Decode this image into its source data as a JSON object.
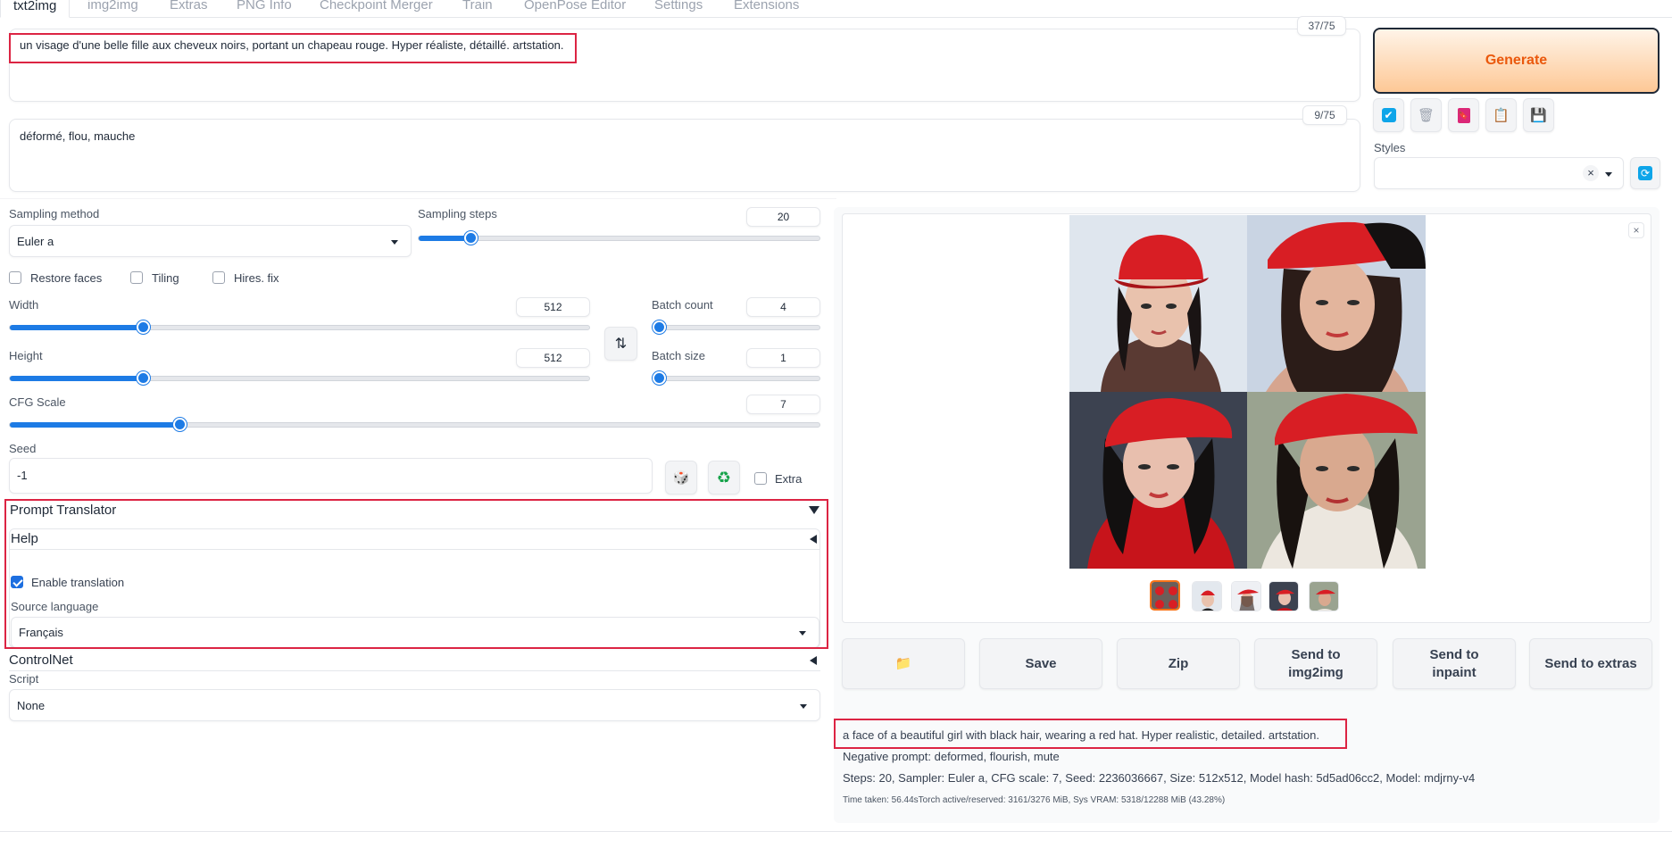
{
  "tabs": [
    "txt2img",
    "img2img",
    "Extras",
    "PNG Info",
    "Checkpoint Merger",
    "Train",
    "OpenPose Editor",
    "Settings",
    "Extensions"
  ],
  "prompt": {
    "text": "un visage d'une belle fille aux cheveux noirs, portant un chapeau rouge. Hyper réaliste, détaillé. artstation.",
    "counter": "37/75"
  },
  "negative_prompt": {
    "text": "déformé, flou, mauche",
    "counter": "9/75"
  },
  "generate_label": "Generate",
  "styles": {
    "label": "Styles",
    "value": ""
  },
  "sampling": {
    "method_label": "Sampling method",
    "method_value": "Euler a",
    "steps_label": "Sampling steps",
    "steps_value": "20",
    "steps_fraction": 0.13
  },
  "checkboxes": {
    "restore_faces": "Restore faces",
    "tiling": "Tiling",
    "hires_fix": "Hires. fix"
  },
  "width": {
    "label": "Width",
    "value": "512",
    "fraction": 0.23
  },
  "height": {
    "label": "Height",
    "value": "512",
    "fraction": 0.23
  },
  "batch_count": {
    "label": "Batch count",
    "value": "4",
    "fraction": 0.04
  },
  "batch_size": {
    "label": "Batch size",
    "value": "1",
    "fraction": 0.0
  },
  "cfg": {
    "label": "CFG Scale",
    "value": "7",
    "fraction": 0.21
  },
  "seed": {
    "label": "Seed",
    "value": "-1",
    "extra_label": "Extra",
    "dice_icon": "🎲",
    "recycle_icon": "♻"
  },
  "prompt_translator": {
    "title": "Prompt Translator",
    "help_title": "Help",
    "enable_label": "Enable translation",
    "enable_checked": true,
    "source_label": "Source language",
    "source_value": "Français"
  },
  "controlnet_title": "ControlNet",
  "script": {
    "label": "Script",
    "value": "None"
  },
  "toolbar_icons": [
    "✔",
    "🗑",
    "🔖",
    "📋",
    "💾"
  ],
  "output_buttons": {
    "folder_icon": "📁",
    "save": "Save",
    "zip": "Zip",
    "send_img2img_line1": "Send to",
    "send_img2img_line2": "img2img",
    "send_inpaint_line1": "Send to",
    "send_inpaint_line2": "inpaint",
    "send_extras": "Send to extras"
  },
  "generation_info": {
    "prompt": "a face of a beautiful girl with black hair, wearing a red hat. Hyper realistic, detailed. artstation.",
    "negative": "Negative prompt: deformed, flourish, mute",
    "params": "Steps: 20, Sampler: Euler a, CFG scale: 7, Seed: 2236036667, Size: 512x512, Model hash: 5d5ad06cc2, Model: mdjrny-v4",
    "time": "Time taken: 56.44sTorch active/reserved: 3161/3276 MiB, Sys VRAM: 5318/12288 MiB (43.28%)"
  },
  "colors": {
    "accent": "#1d7be5",
    "generate_bg": "#fed7aa",
    "generate_text": "#ea580c",
    "highlight": "#dc2443"
  }
}
